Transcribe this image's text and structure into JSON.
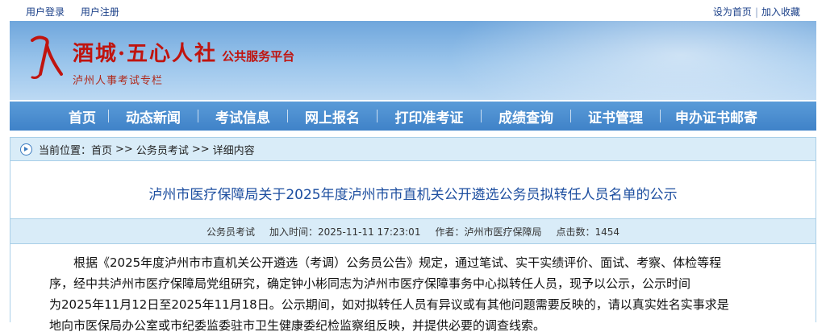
{
  "topbar": {
    "login": "用户登录",
    "register": "用户注册",
    "set_home": "设为首页",
    "separator": "|",
    "bookmark": "加入收藏"
  },
  "banner": {
    "title": "酒城·五心人社",
    "subtitle": "公共服务平台",
    "tagline": "泸州人事考试专栏",
    "brand_color": "#c0140f"
  },
  "nav": {
    "items": [
      "首页",
      "动态新闻",
      "考试信息",
      "网上报名",
      "打印准考证",
      "成绩查询",
      "证书管理",
      "申办证书邮寄"
    ]
  },
  "breadcrumb": {
    "prefix": "当前位置：",
    "home": "首页",
    "separator": ">>",
    "section": "公务员考试",
    "current": "详细内容"
  },
  "article": {
    "title": "泸州市医疗保障局关于2025年度泸州市市直机关公开遴选公务员拟转任人员名单的公示",
    "meta": {
      "category": "公务员考试",
      "time": "加入时间：2025-11-11 17:23:01",
      "author": "作者：泸州市医疗保障局",
      "hits": "点击数：1454"
    },
    "lines": [
      "根据《2025年度泸州市市直机关公开遴选（考调）公务员公告》规定，通过笔试、实干实绩评价、面试、考察、体检等程",
      "序，经中共泸州市医疗保障局党组研究，确定钟小彬同志为泸州市医疗保障事务中心拟转任人员，现予以公示，公示时间",
      "为2025年11月12日至2025年11月18日。公示期间，如对拟转任人员有异议或有其他问题需要反映的，请以真实姓名实事求是",
      "地向市医保局办公室或市纪委监委驻市卫生健康委纪检监察组反映，并提供必要的调查线索。"
    ]
  }
}
